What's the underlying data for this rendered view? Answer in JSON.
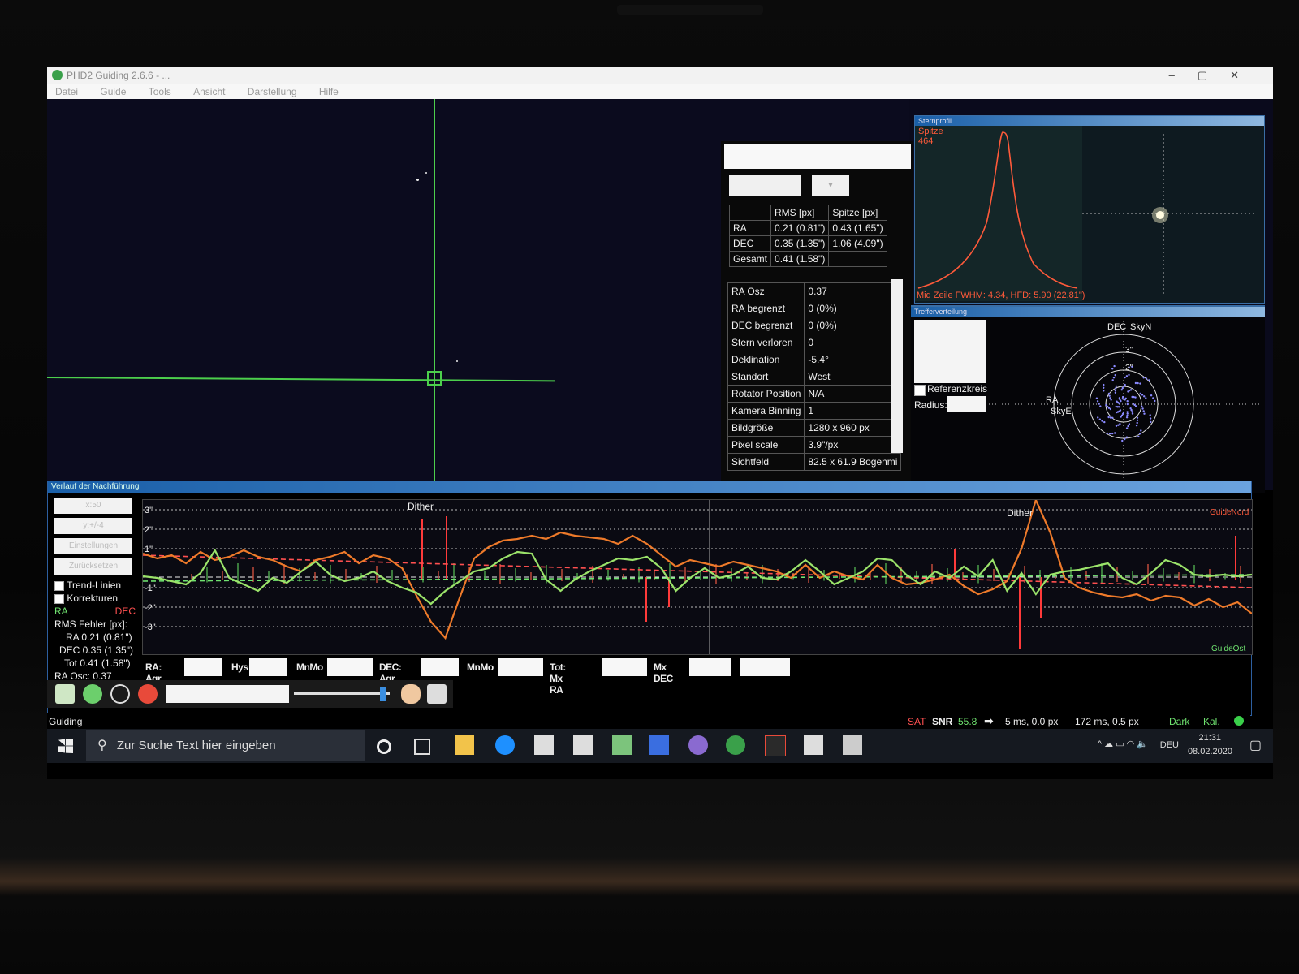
{
  "window": {
    "title": "PHD2 Guiding 2.6.6 - ..."
  },
  "menu": [
    "Datei",
    "Guide",
    "Tools",
    "Ansicht",
    "Darstellung",
    "Hilfe"
  ],
  "stats": {
    "headers": [
      "",
      "RMS [px]",
      "Spitze [px]"
    ],
    "rows": [
      {
        "label": "RA",
        "rms": "0.21 (0.81\")",
        "peak": "0.43 (1.65\")"
      },
      {
        "label": "DEC",
        "rms": "0.35 (1.35\")",
        "peak": "1.06 (4.09\")"
      },
      {
        "label": "Gesamt",
        "rms": "0.41 (1.58\")",
        "peak": ""
      }
    ]
  },
  "info": [
    {
      "k": "RA Osz",
      "v": "0.37"
    },
    {
      "k": "RA begrenzt",
      "v": "0 (0%)"
    },
    {
      "k": "DEC begrenzt",
      "v": "0 (0%)"
    },
    {
      "k": "Stern verloren",
      "v": "0"
    },
    {
      "k": "Deklination",
      "v": "-5.4°"
    },
    {
      "k": "Standort",
      "v": "West"
    },
    {
      "k": "Rotator Position",
      "v": "N/A"
    },
    {
      "k": "Kamera Binning",
      "v": "1"
    },
    {
      "k": "Bildgröße",
      "v": "1280 x 960 px"
    },
    {
      "k": "Pixel scale",
      "v": "3.9\"/px"
    },
    {
      "k": "Sichtfeld",
      "v": "82.5 x 61.9 Bogenmi"
    }
  ],
  "starprofile": {
    "title": "Sternprofil",
    "peak_label": "Spitze",
    "peak_value": "464",
    "fwhm_text": "Mid Zeile FWHM: 4.34, HFD: 5.90 (22.81\")"
  },
  "target": {
    "title": "Trefferverteilung",
    "dec_label": "DEC",
    "skyn": "SkyN",
    "ra_label": "RA",
    "skye": "SkyE",
    "ring3": "3\"",
    "ring2": "2\"",
    "ref_label": "Referenzkreis",
    "radius_label": "Radius:"
  },
  "history": {
    "title": "Verlauf der Nachführung",
    "btn_x": "x:50",
    "btn_y": "y:+/-4",
    "btn_settings": "Einstellungen",
    "btn_clear": "Zurücksetzen",
    "trend_label": "Trend-Linien",
    "corr_label": "Korrekturen",
    "ra_label": "RA",
    "dec_label": "DEC",
    "rms_title": "RMS Fehler [px]:",
    "rms_ra": "RA 0.21 (0.81\")",
    "rms_dec": "DEC 0.35 (1.35\")",
    "rms_tot": "Tot 0.41 (1.58\")",
    "ra_osc": "RA Osc: 0.37",
    "y_labels": [
      "3\"",
      "2\"",
      "1\"",
      "-1\"",
      "-2\"",
      "-3\""
    ],
    "dither": "Dither",
    "guide_nord": "GuideNord",
    "guide_ost": "GuideOst",
    "bottom_labels": {
      "ra_agr": "RA: Agr",
      "hys": "Hys",
      "mnmo1": "MnMo",
      "dec_agr": "DEC: Agr",
      "mnmo2": "MnMo",
      "tot_mx_ra": "Tot: Mx RA",
      "mx_dec": "Mx DEC"
    }
  },
  "status": {
    "mode": "Guiding",
    "sat": "SAT",
    "snr_label": "SNR",
    "snr_value": "55.8",
    "guide_text": "5 ms, 0.0 px",
    "exp_text": "172 ms, 0.5 px",
    "dark": "Dark",
    "kal": "Kal."
  },
  "taskbar": {
    "search_placeholder": "Zur Suche Text hier eingeben",
    "lang": "DEU",
    "time": "21:31",
    "date": "08.02.2020"
  },
  "colors": {
    "ra": "#e0602a",
    "dec": "#6fe26f",
    "grid": "#cfcfcf"
  }
}
